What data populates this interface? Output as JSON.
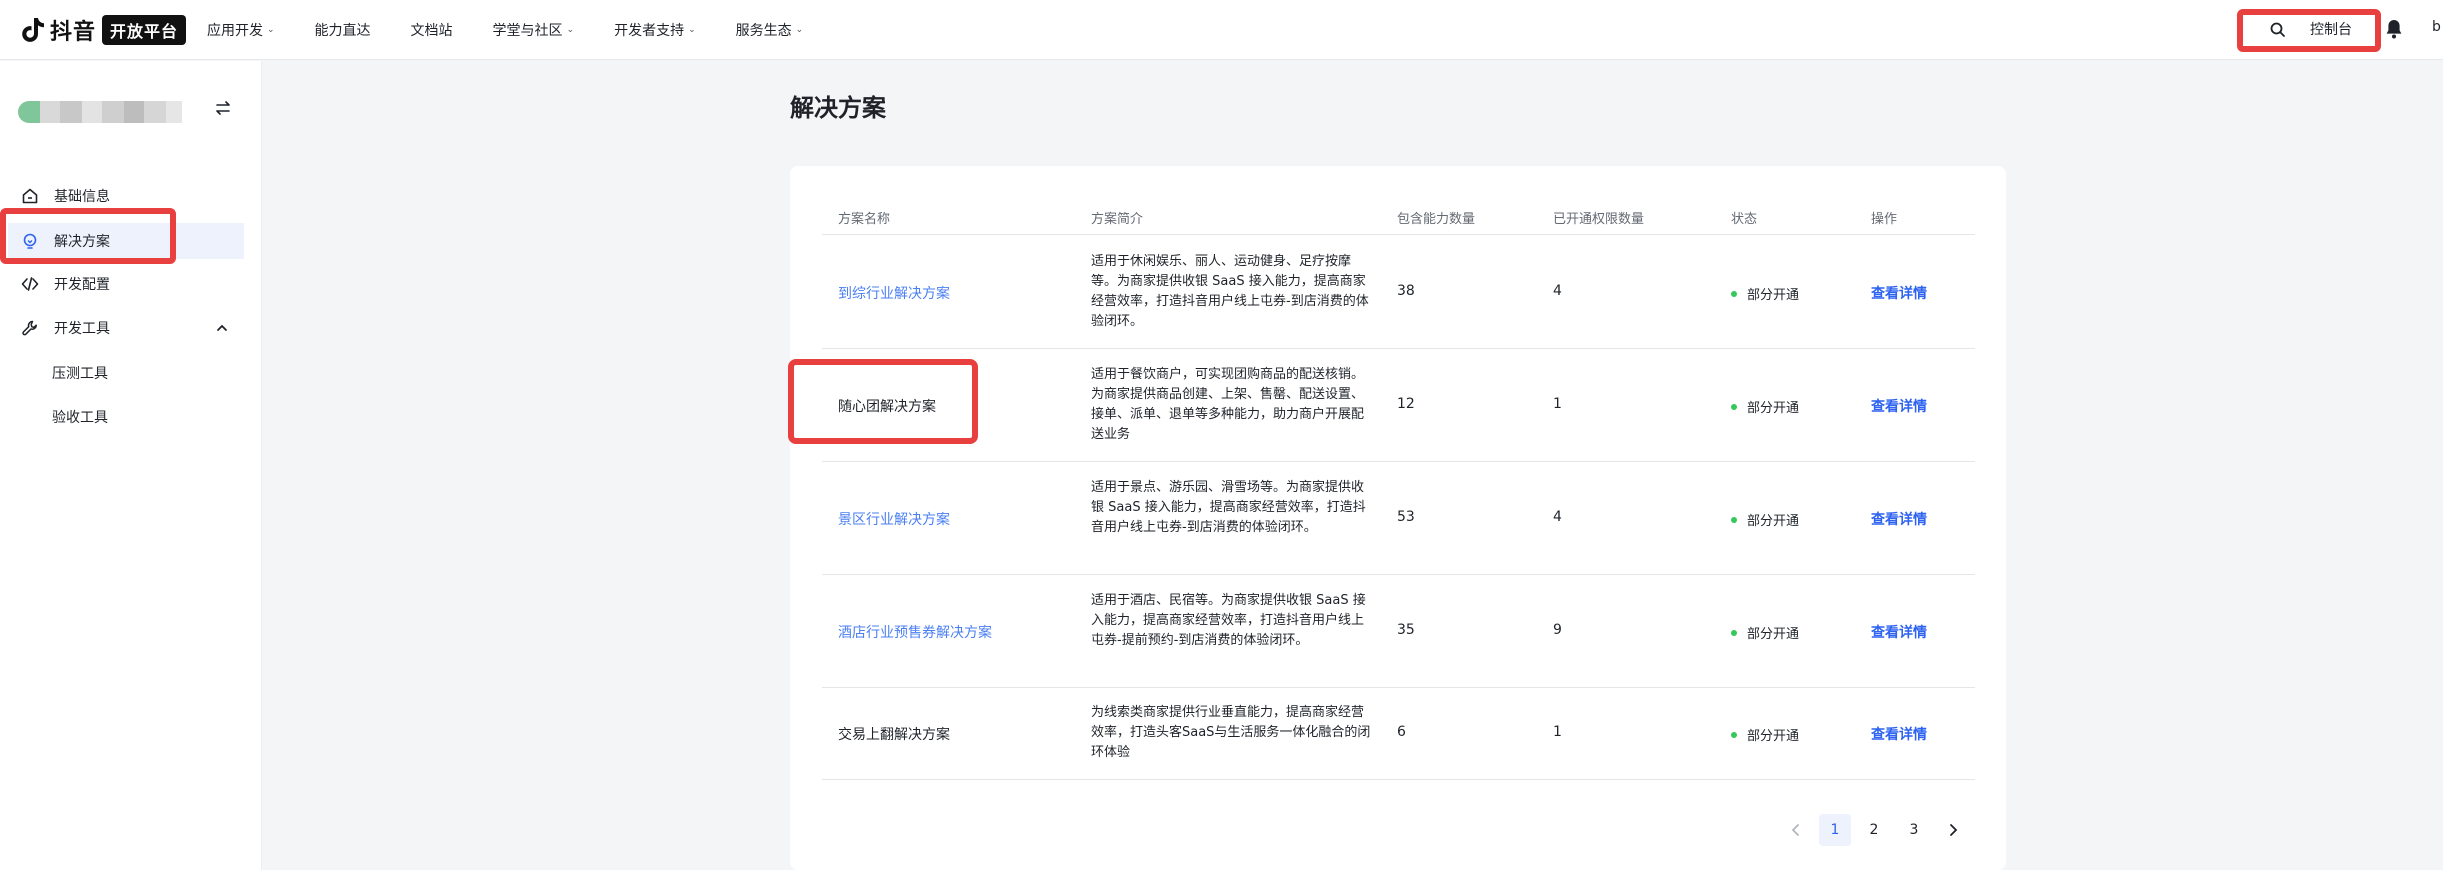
{
  "brand": {
    "name": "抖音",
    "badge": "开放平台"
  },
  "nav": [
    {
      "label": "应用开发",
      "has_dropdown": true
    },
    {
      "label": "能力直达",
      "has_dropdown": false
    },
    {
      "label": "文档站",
      "has_dropdown": false
    },
    {
      "label": "学堂与社区",
      "has_dropdown": true
    },
    {
      "label": "开发者支持",
      "has_dropdown": true
    },
    {
      "label": "服务生态",
      "has_dropdown": true
    }
  ],
  "topright": {
    "console_label": "控制台",
    "user_name_clipped": "b"
  },
  "sidebar": {
    "menu": [
      {
        "label": "基础信息",
        "icon": "home-icon",
        "active": false
      },
      {
        "label": "解决方案",
        "icon": "lightbulb-icon",
        "active": true
      },
      {
        "label": "开发配置",
        "icon": "code-icon",
        "active": false
      },
      {
        "label": "开发工具",
        "icon": "wrench-icon",
        "active": false,
        "expanded": true
      }
    ],
    "submenu": [
      {
        "label": "压测工具"
      },
      {
        "label": "验收工具"
      }
    ]
  },
  "page": {
    "title": "解决方案"
  },
  "table": {
    "headers": [
      "方案名称",
      "方案简介",
      "包含能力数量",
      "已开通权限数量",
      "状态",
      "操作"
    ],
    "rows": [
      {
        "name": "到综行业解决方案",
        "name_is_link": true,
        "desc": "适用于休闲娱乐、丽人、运动健身、足疗按摩等。为商家提供收银 SaaS 接入能力，提高商家经营效率，打造抖音用户线上屯券-到店消费的体验闭环。",
        "abilities": "38",
        "granted": "4",
        "status": "部分开通",
        "action": "查看详情"
      },
      {
        "name": "随心团解决方案",
        "name_is_link": false,
        "desc": "适用于餐饮商户，可实现团购商品的配送核销。为商家提供商品创建、上架、售罄、配送设置、接单、派单、退单等多种能力，助力商户开展配送业务",
        "abilities": "12",
        "granted": "1",
        "status": "部分开通",
        "action": "查看详情"
      },
      {
        "name": "景区行业解决方案",
        "name_is_link": true,
        "desc": "适用于景点、游乐园、滑雪场等。为商家提供收银 SaaS 接入能力，提高商家经营效率，打造抖音用户线上屯券-到店消费的体验闭环。",
        "abilities": "53",
        "granted": "4",
        "status": "部分开通",
        "action": "查看详情"
      },
      {
        "name": "酒店行业预售券解决方案",
        "name_is_link": true,
        "desc": "适用于酒店、民宿等。为商家提供收银 SaaS 接入能力，提高商家经营效率，打造抖音用户线上屯券-提前预约-到店消费的体验闭环。",
        "abilities": "35",
        "granted": "9",
        "status": "部分开通",
        "action": "查看详情"
      },
      {
        "name": "交易上翻解决方案",
        "name_is_link": false,
        "desc": "为线索类商家提供行业垂直能力，提高商家经营效率，打造头客SaaS与生活服务一体化融合的闭环体验",
        "abilities": "6",
        "granted": "1",
        "status": "部分开通",
        "action": "查看详情"
      }
    ]
  },
  "pagination": {
    "pages": [
      "1",
      "2",
      "3"
    ],
    "current": "1"
  },
  "colors": {
    "highlight": "#e8403e",
    "link": "#4a7ff2",
    "action": "#2d63f0",
    "status_dot": "#34c759"
  }
}
